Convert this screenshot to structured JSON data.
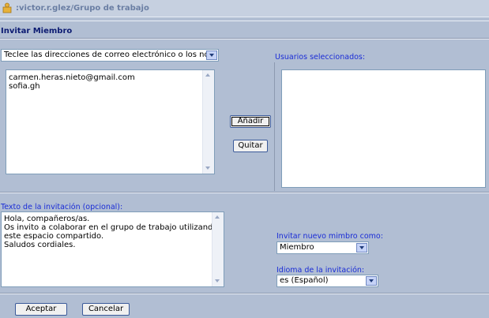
{
  "header": {
    "breadcrumb": ":victor.r.glez/Grupo de trabajo",
    "logo": "folder-person-icon"
  },
  "section_title": "Invitar Miembro",
  "email_input": {
    "selected": "Teclee las direcciones de correo electrónico o los nom",
    "lines": [
      "carmen.heras.nieto@gmail.com",
      "sofia.gh"
    ]
  },
  "selected_users": {
    "label": "Usuarios seleccionados:"
  },
  "actions": {
    "add_label": "Añadir",
    "remove_label": "Quitar"
  },
  "invitation_text": {
    "label": "Texto de la invitación (opcional):",
    "lines": [
      "Hola, compañeros/as.",
      "Os invito a colaborar en el grupo de trabajo utilizando",
      "este espacio compartido.",
      "Saludos cordiales."
    ]
  },
  "invite_as": {
    "label": "Invitar nuevo mimbro como:",
    "selected": "Miembro"
  },
  "language": {
    "label": "Idioma de la invitación:",
    "selected": "es (Español)"
  },
  "footer": {
    "accept_label": "Aceptar",
    "cancel_label": "Cancelar"
  },
  "colors": {
    "background": "#b1bed3",
    "title": "#0c1b72",
    "label": "#1a2cd6",
    "crumb": "#6a7ea3"
  }
}
